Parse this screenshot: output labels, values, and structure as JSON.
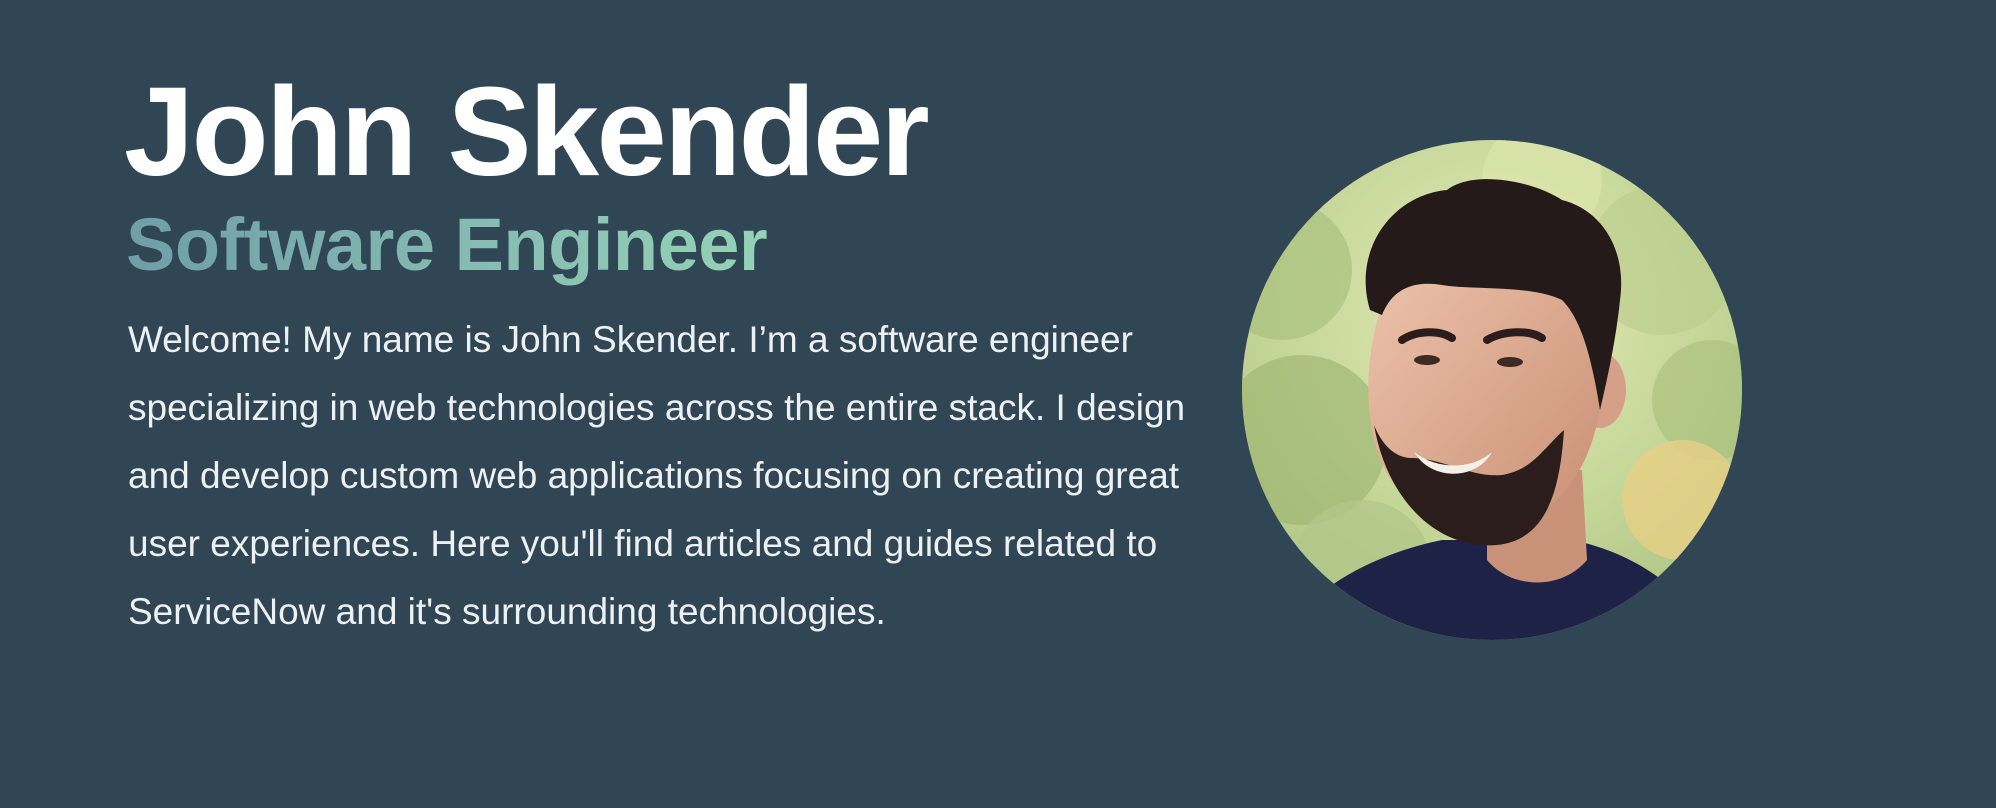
{
  "hero": {
    "name": "John Skender",
    "role": "Software Engineer",
    "bio": "Welcome! My name is John Skender. I’m a software engineer specializing in web technologies across the entire stack. I design and develop custom web applications focusing on creating great user experiences. Here you'll find articles and guides related to ServiceNow and it's surrounding technologies."
  },
  "avatar": {
    "icon": "profile-photo"
  },
  "colors": {
    "background": "#304654",
    "name_text": "#ffffff",
    "role_gradient_start": "#6f9ea8",
    "role_gradient_end": "#95d3b6",
    "body_text": "#eef1f3"
  }
}
